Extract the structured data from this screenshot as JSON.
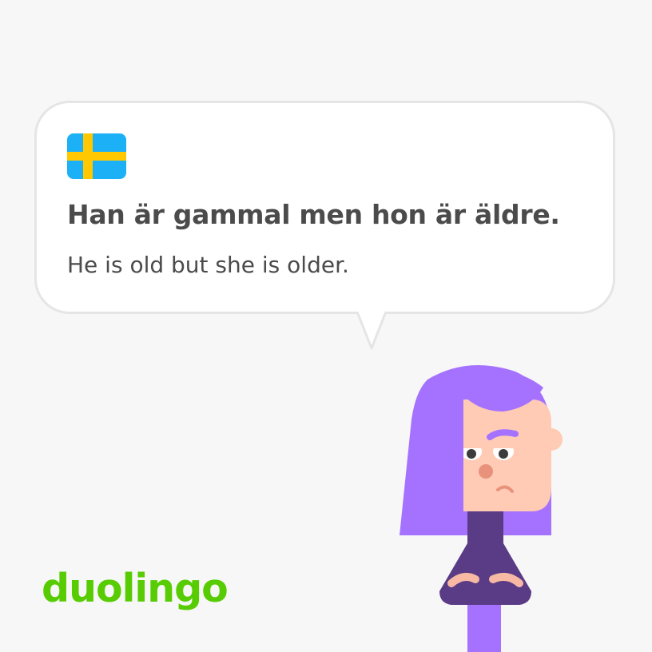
{
  "card": {
    "flag_icon": "sweden-flag-icon",
    "sentence": "Han är gammal men hon är äldre.",
    "translation": "He is old but she is older."
  },
  "brand": {
    "logo_text": "duolingo"
  },
  "character": {
    "icon": "lily-character"
  },
  "colors": {
    "background": "#f7f7f7",
    "brand_green": "#58cc02",
    "text": "#4b4b4b",
    "flag_blue": "#1cb0f6",
    "flag_yellow": "#ffc800",
    "hair": "#a572ff",
    "shirt": "#5a3b86",
    "skin": "#ffcbb5"
  }
}
